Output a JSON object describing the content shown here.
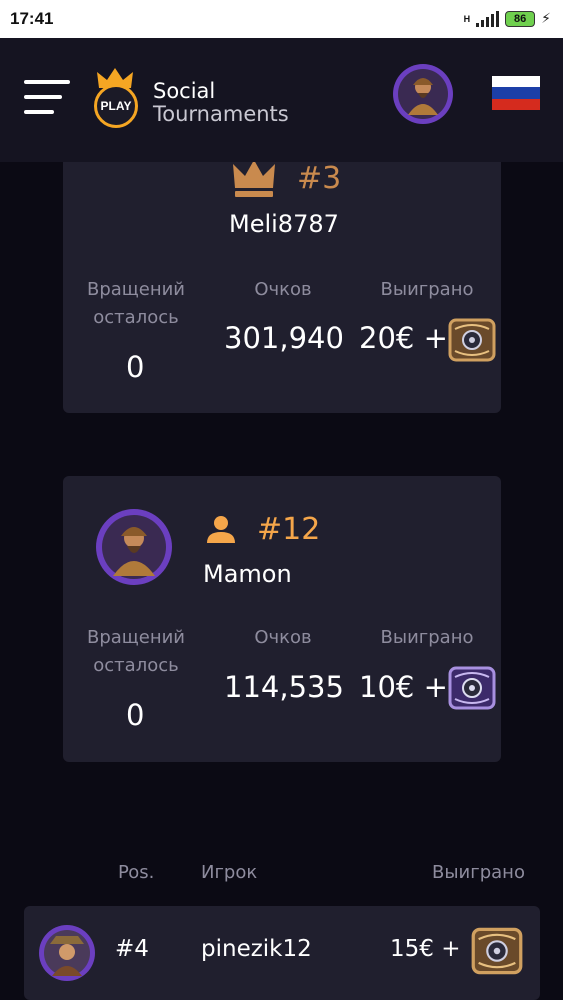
{
  "status_bar": {
    "time": "17:41",
    "network": "H",
    "battery": "86"
  },
  "header": {
    "brand_line1": "Social",
    "brand_line2": "Tournaments",
    "logo_text": "PLAY"
  },
  "top_card": {
    "rank": "#3",
    "name": "Meli8787",
    "spins_label_1": "Вращений",
    "spins_label_2": "осталось",
    "spins_value": "0",
    "points_label": "Очков",
    "points_value": "301,940",
    "won_label": "Выиграно",
    "won_value": "20€ +"
  },
  "my_card": {
    "rank": "#12",
    "name": "Mamon",
    "spins_label_1": "Вращений",
    "spins_label_2": "осталось",
    "spins_value": "0",
    "points_label": "Очков",
    "points_value": "114,535",
    "won_label": "Выиграно",
    "won_value": "10€ +"
  },
  "leaderboard": {
    "col_pos": "Pos.",
    "col_player": "Игрок",
    "col_won": "Выиграно",
    "rows": [
      {
        "pos": "#4",
        "name": "pinezik12",
        "won": "15€ +"
      }
    ]
  },
  "colors": {
    "accent": "#f5a64a",
    "card_bg": "#201f2e",
    "page_bg": "#0b0a14",
    "header_bg": "#151421"
  }
}
